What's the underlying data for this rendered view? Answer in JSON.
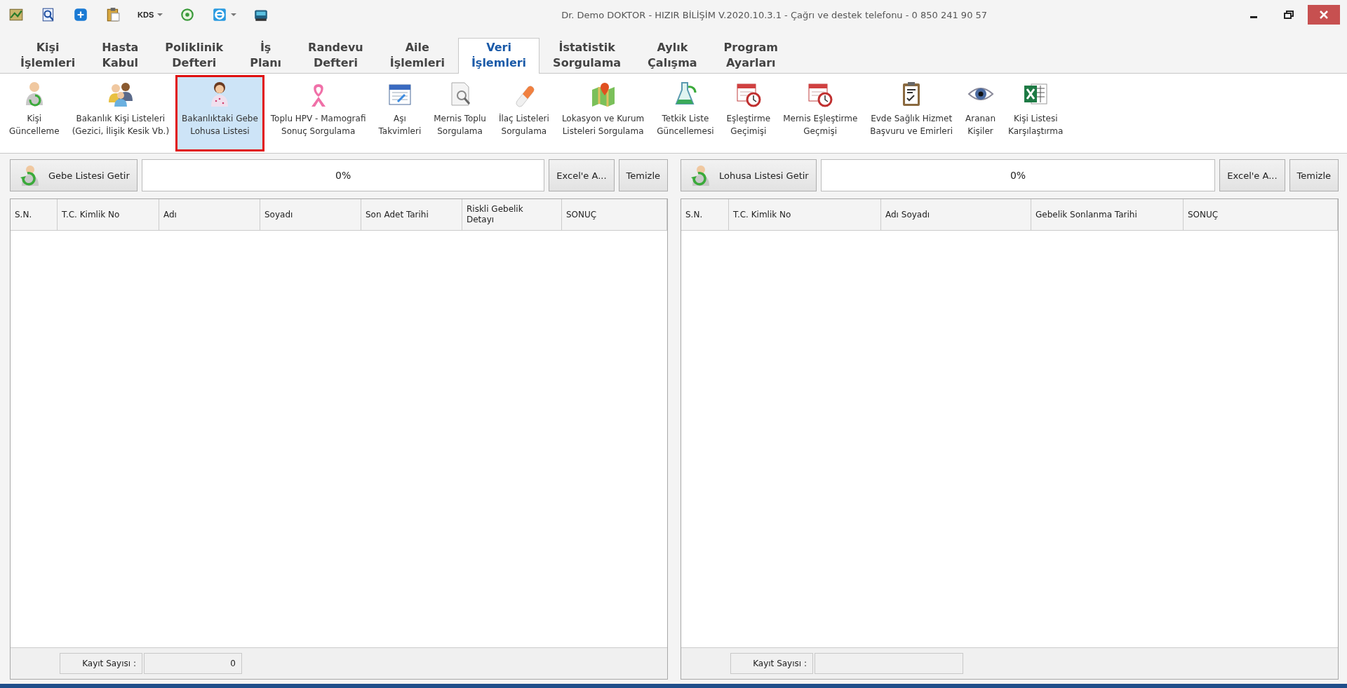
{
  "window": {
    "title": "Dr. Demo DOKTOR - HIZIR BİLİŞİM V.2020.10.3.1 - Çağrı ve destek telefonu - 0 850 241 90 57"
  },
  "quick_access": [
    {
      "kind": "icon",
      "dropdown": false
    },
    {
      "kind": "icon",
      "dropdown": false
    },
    {
      "kind": "icon",
      "dropdown": false
    },
    {
      "kind": "icon",
      "dropdown": false
    },
    {
      "kind": "text",
      "label": "KDS",
      "dropdown": true
    },
    {
      "kind": "icon",
      "dropdown": false
    },
    {
      "kind": "icon",
      "dropdown": true
    },
    {
      "kind": "icon",
      "dropdown": false
    }
  ],
  "tabs": [
    {
      "label": "Kişi\nİşlemleri",
      "selected": false
    },
    {
      "label": "Hasta\nKabul",
      "selected": false
    },
    {
      "label": "Poliklinik\nDefteri",
      "selected": false
    },
    {
      "label": "İş\nPlanı",
      "selected": false
    },
    {
      "label": "Randevu\nDefteri",
      "selected": false
    },
    {
      "label": "Aile\nİşlemleri",
      "selected": false
    },
    {
      "label": "Veri\nİşlemleri",
      "selected": true
    },
    {
      "label": "İstatistik\nSorgulama",
      "selected": false
    },
    {
      "label": "Aylık\nÇalışma",
      "selected": false
    },
    {
      "label": "Program\nAyarları",
      "selected": false
    }
  ],
  "toolbar": [
    {
      "label": "Kişi\nGüncelleme",
      "selected": false
    },
    {
      "label": "Bakanlık Kişi Listeleri\n(Gezici, İlişik Kesik Vb.)",
      "selected": false
    },
    {
      "label": "Bakanlıktaki Gebe\nLohusa Listesi",
      "selected": true
    },
    {
      "label": "Toplu HPV - Mamografi\nSonuç Sorgulama",
      "selected": false
    },
    {
      "label": "Aşı\nTakvimleri",
      "selected": false
    },
    {
      "label": "Mernis Toplu\nSorgulama",
      "selected": false
    },
    {
      "label": "İlaç Listeleri\nSorgulama",
      "selected": false
    },
    {
      "label": "Lokasyon ve Kurum\nListeleri Sorgulama",
      "selected": false
    },
    {
      "label": "Tetkik Liste\nGüncellemesi",
      "selected": false
    },
    {
      "label": "Eşleştirme\nGeçimişi",
      "selected": false
    },
    {
      "label": "Mernis Eşleştirme\nGeçmişi",
      "selected": false
    },
    {
      "label": "Evde Sağlık Hizmet\nBaşvuru ve Emirleri",
      "selected": false
    },
    {
      "label": "Aranan\nKişiler",
      "selected": false
    },
    {
      "label": "Kişi Listesi\nKarşılaştırma",
      "selected": false
    }
  ],
  "panels": [
    {
      "fetch_button": "Gebe Listesi Getir",
      "progress": {
        "level": 0,
        "reading": "0%"
      },
      "export_button": "Excel'e A...",
      "clear_button": "Temizle",
      "columns": [
        "S.N.",
        "T.C. Kimlik No",
        "Adı",
        "Soyadı",
        "Son Adet Tarihi",
        "Riskli Gebelik\nDetayı",
        "SONUÇ"
      ],
      "count_label": "Kayıt Sayısı :",
      "count_value": "0"
    },
    {
      "fetch_button": "Lohusa Listesi Getir",
      "progress": {
        "level": 0,
        "reading": "0%"
      },
      "export_button": "Excel'e A...",
      "clear_button": "Temizle",
      "columns": [
        "S.N.",
        "T.C. Kimlik No",
        "Adı Soyadı",
        "Gebelik Sonlanma Tarihi",
        "SONUÇ"
      ],
      "count_label": "Kayıt Sayısı :"
    }
  ]
}
